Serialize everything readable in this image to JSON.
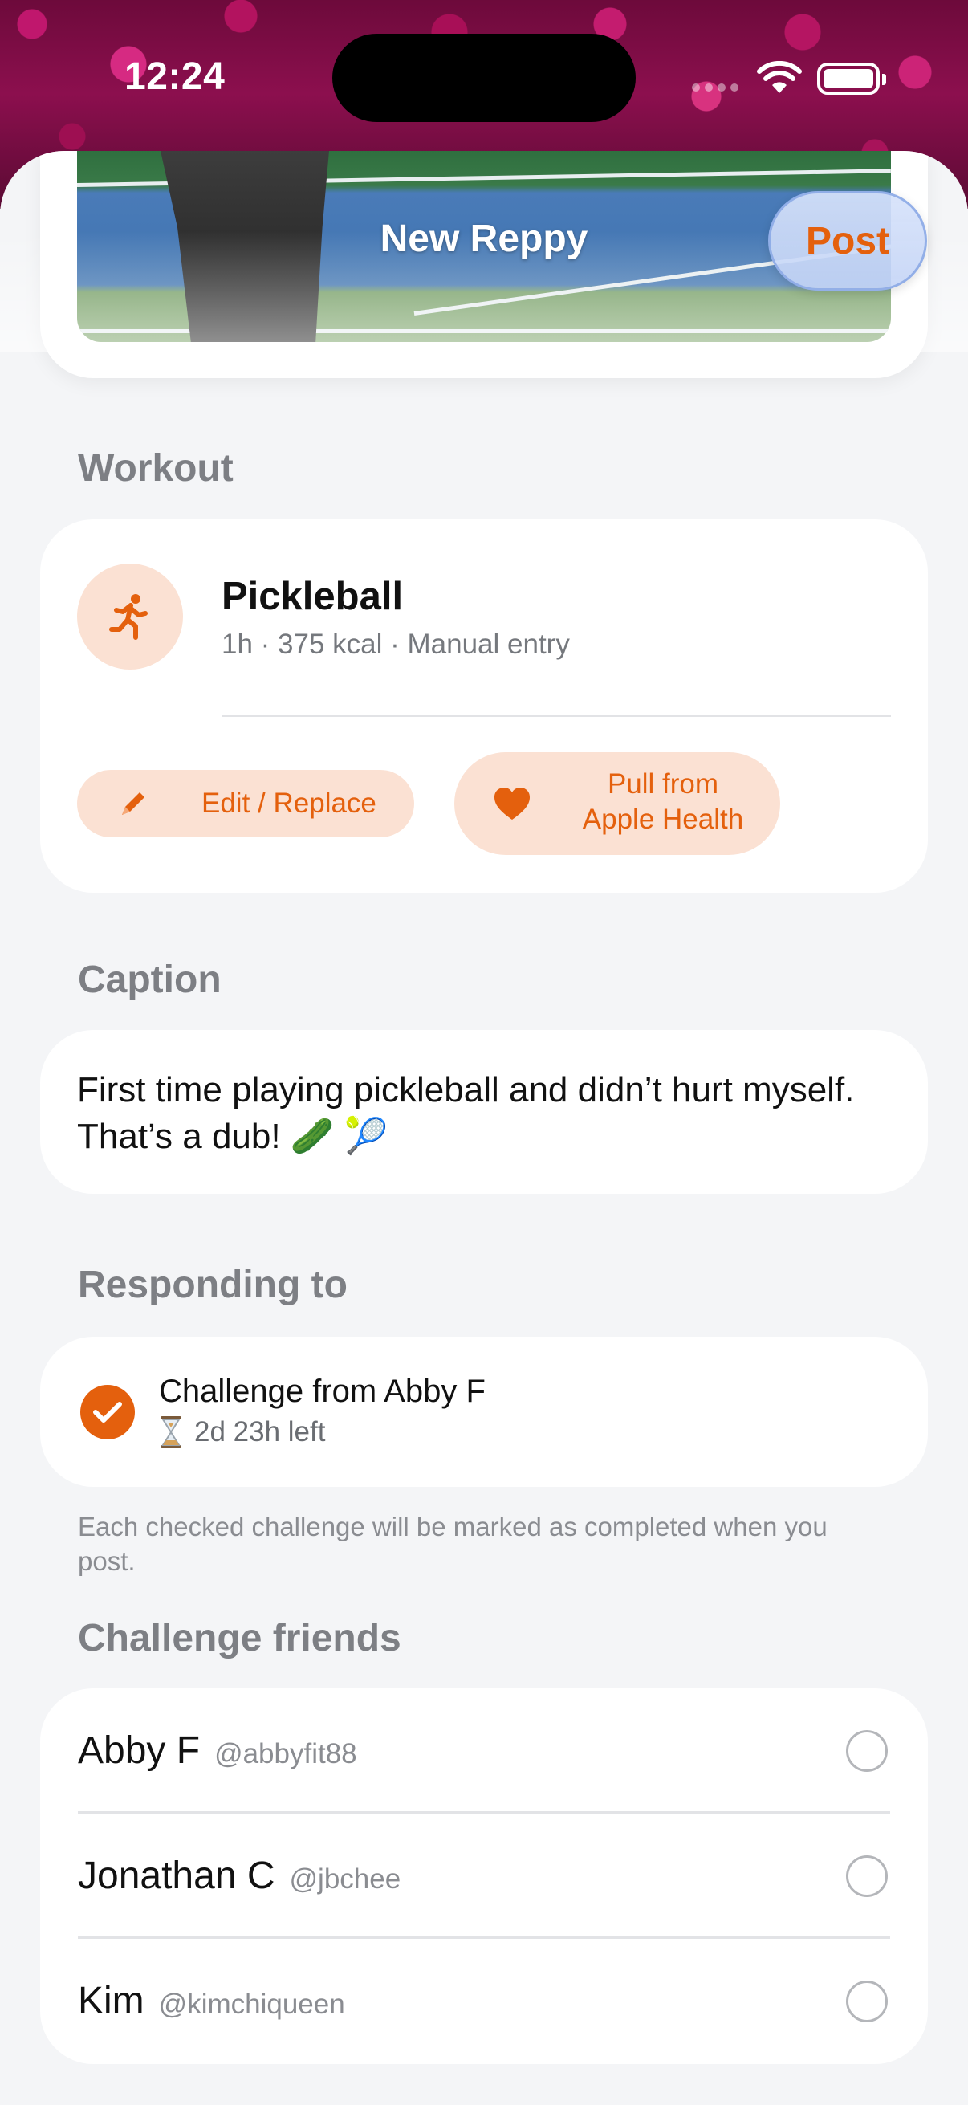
{
  "status_bar": {
    "time": "12:24"
  },
  "header": {
    "title": "New Reppy",
    "post_label": "Post"
  },
  "workout": {
    "section_title": "Workout",
    "icon": "running-person-icon",
    "name": "Pickleball",
    "meta": "1h · 375 kcal · Manual entry",
    "edit_label": "Edit / Replace",
    "health_label_line1": "Pull from",
    "health_label_line2": "Apple Health"
  },
  "caption": {
    "section_title": "Caption",
    "text": "First time playing pickleball and didn’t hurt myself. That’s a dub! 🥒 🎾"
  },
  "responding": {
    "section_title": "Responding to",
    "challenge_title": "Challenge from Abby F",
    "time_left": "2d 23h left",
    "checked": true,
    "hint": "Each checked challenge will be marked as completed when you post."
  },
  "challenge_friends": {
    "section_title": "Challenge friends",
    "friends": [
      {
        "name": "Abby F",
        "handle": "@abbyfit88",
        "selected": false
      },
      {
        "name": "Jonathan C",
        "handle": "@jbchee",
        "selected": false
      },
      {
        "name": "Kim",
        "handle": "@kimchiqueen",
        "selected": false
      }
    ]
  },
  "colors": {
    "accent": "#e4600d",
    "accent_soft": "#fbe1d3",
    "background": "#f4f5f7",
    "card": "#ffffff",
    "section_title": "#7d7f84"
  }
}
